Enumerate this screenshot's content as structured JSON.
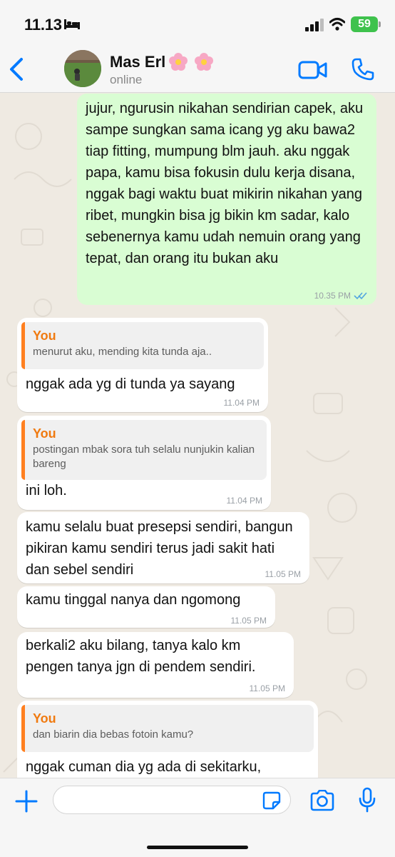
{
  "status": {
    "time": "11.13",
    "battery": "59"
  },
  "header": {
    "contact_name": "Mas Erl",
    "contact_status": "online"
  },
  "messages": [
    {
      "dir": "out",
      "text": "jujur, ngurusin nikahan sendirian capek, aku sampe sungkan sama icang yg aku bawa2 tiap fitting, mumpung blm jauh. aku nggak papa, kamu bisa fokusin dulu kerja disana, nggak bagi waktu buat mikirin nikahan yang ribet, mungkin bisa jg bikin km sadar, kalo sebenernya kamu udah nemuin orang yang tepat, dan orang itu bukan aku",
      "time": "10.35 PM"
    },
    {
      "dir": "in",
      "quote_author": "You",
      "quote_text": "menurut aku, mending kita tunda aja..",
      "text": "nggak ada yg di tunda ya sayang",
      "time": "11.04 PM"
    },
    {
      "dir": "in",
      "quote_author": "You",
      "quote_text": "postingan mbak sora tuh selalu nunjukin kalian bareng",
      "text": "ini loh.",
      "time": "11.04 PM"
    },
    {
      "dir": "in",
      "text": "kamu selalu buat presepsi sendiri, bangun pikiran kamu sendiri terus jadi sakit hati dan sebel sendiri",
      "time": "11.05 PM"
    },
    {
      "dir": "in",
      "text": "kamu tinggal nanya dan ngomong",
      "time": "11.05 PM"
    },
    {
      "dir": "in",
      "text": "berkali2 aku bilang, tanya kalo km pengen tanya jgn di pendem sendiri.",
      "time": "11.05 PM"
    },
    {
      "dir": "in",
      "quote_author": "You",
      "quote_text": "dan biarin dia bebas fotoin kamu?",
      "text": "nggak cuman dia yg ada di sekitarku,",
      "time": ""
    }
  ],
  "input": {
    "value": ""
  },
  "colors": {
    "accent": "#007aff",
    "outgoing_bubble": "#d9fdd3",
    "incoming_bubble": "#ffffff",
    "quote_author": "#f07a10",
    "chat_background": "#efeae2"
  },
  "icons": [
    "back-icon",
    "video-call-icon",
    "phone-icon",
    "plus-icon",
    "sticker-icon",
    "camera-icon",
    "microphone-icon",
    "read-receipt-icon"
  ]
}
